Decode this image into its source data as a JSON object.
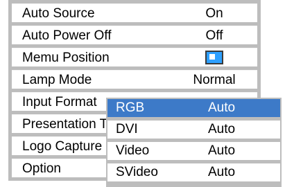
{
  "menu": {
    "items": [
      {
        "label": "Auto Source",
        "value": "On"
      },
      {
        "label": "Auto Power Off",
        "value": "Off"
      },
      {
        "label": "Memu Position",
        "icon": "menu-position-icon"
      },
      {
        "label": "Lamp Mode",
        "value": "Normal"
      },
      {
        "label": "Input Format"
      },
      {
        "label": "Presentation T"
      },
      {
        "label": "Logo Capture"
      },
      {
        "label": "Option"
      }
    ]
  },
  "submenu": {
    "items": [
      {
        "label": "RGB",
        "value": "Auto",
        "selected": true
      },
      {
        "label": "DVI",
        "value": "Auto"
      },
      {
        "label": "Video",
        "value": "Auto"
      },
      {
        "label": "SVideo",
        "value": "Auto"
      }
    ]
  },
  "colors": {
    "selected": "#3d7ac8",
    "frame": "#bdbdbd",
    "icon_fill": "#2ea0ff"
  }
}
